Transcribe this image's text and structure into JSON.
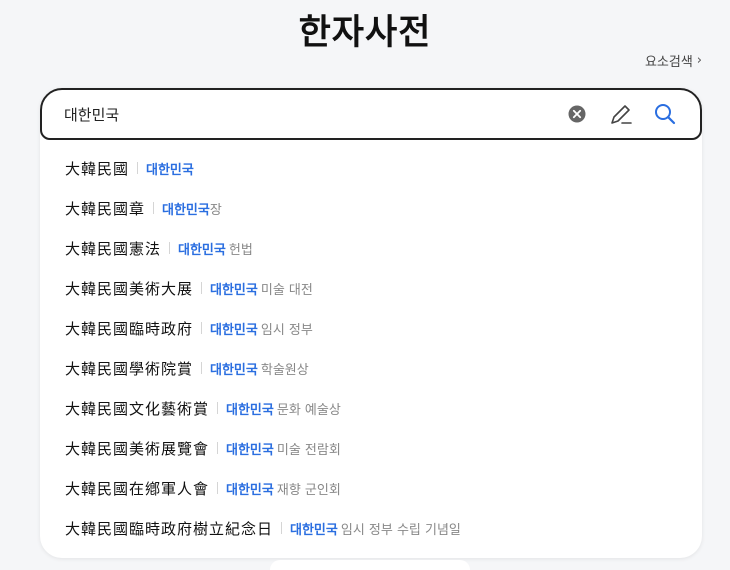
{
  "header": {
    "title": "한자사전",
    "element_search_label": "요소검색",
    "element_search_chevron": "›"
  },
  "search": {
    "value": "대한민국",
    "clear_icon": "clear-icon",
    "handwriting_icon": "pencil-icon",
    "search_icon": "search-icon"
  },
  "colors": {
    "accent": "#2a6ee0",
    "text": "#111111",
    "muted": "#888888"
  },
  "results": [
    {
      "hanja": "大韓民國",
      "hangul": "대한민국",
      "rest": ""
    },
    {
      "hanja": "大韓民國章",
      "hangul": "대한민국",
      "rest": "장"
    },
    {
      "hanja": "大韓民國憲法",
      "hangul": "대한민국",
      "rest": "헌법"
    },
    {
      "hanja": "大韓民國美術大展",
      "hangul": "대한민국",
      "rest": "미술 대전"
    },
    {
      "hanja": "大韓民國臨時政府",
      "hangul": "대한민국",
      "rest": "임시 정부"
    },
    {
      "hanja": "大韓民國學術院賞",
      "hangul": "대한민국",
      "rest": "학술원상"
    },
    {
      "hanja": "大韓民國文化藝術賞",
      "hangul": "대한민국",
      "rest": "문화 예술상"
    },
    {
      "hanja": "大韓民國美術展覽會",
      "hangul": "대한민국",
      "rest": "미술 전람회"
    },
    {
      "hanja": "大韓民國在鄕軍人會",
      "hangul": "대한민국",
      "rest": "재향 군인회"
    },
    {
      "hanja": "大韓民國臨時政府樹立紀念日",
      "hangul": "대한민국",
      "rest": "임시 정부 수립 기념일"
    }
  ]
}
